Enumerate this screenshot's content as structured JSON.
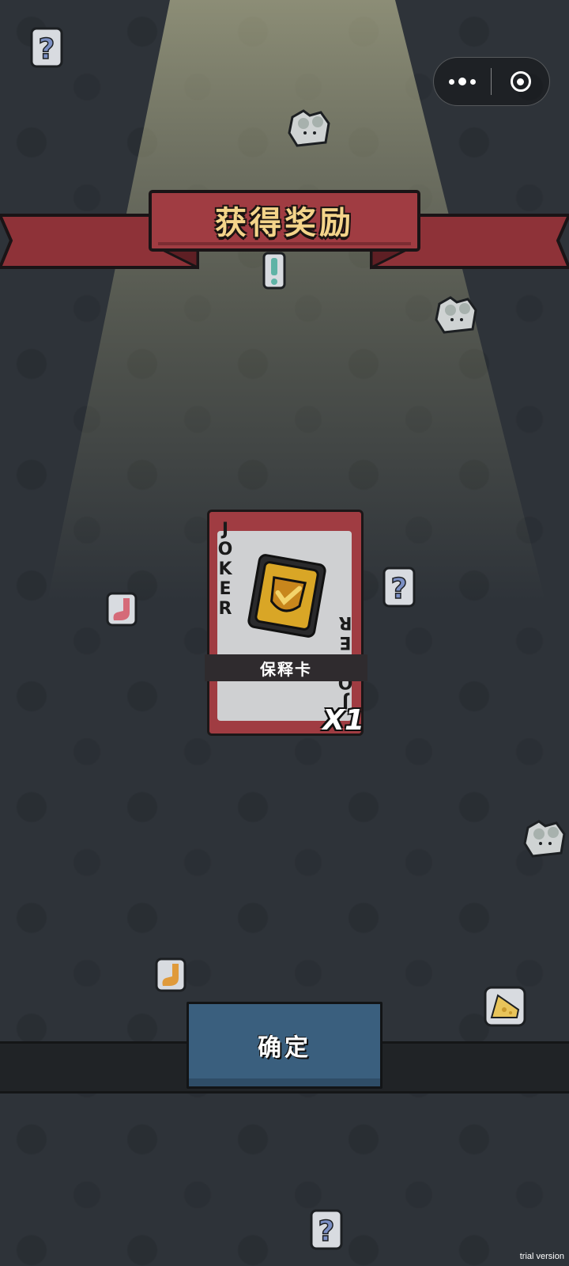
{
  "banner": {
    "title": "获得奖励"
  },
  "capsule": {
    "more_icon": "more-dots-icon",
    "close_icon": "target-close-icon"
  },
  "reward_card": {
    "corner_text": "JOKER",
    "corner_text_bottom": "JOKER",
    "name": "保释卡",
    "quantity": "X1",
    "icon": "gold-shield-badge-icon"
  },
  "confirm_button": {
    "label": "确定"
  },
  "watermark": "trial version",
  "colors": {
    "background": "#2e3339",
    "banner_red": "#a03c42",
    "banner_text": "#f4d48a",
    "button_blue": "#3a5f7e"
  }
}
